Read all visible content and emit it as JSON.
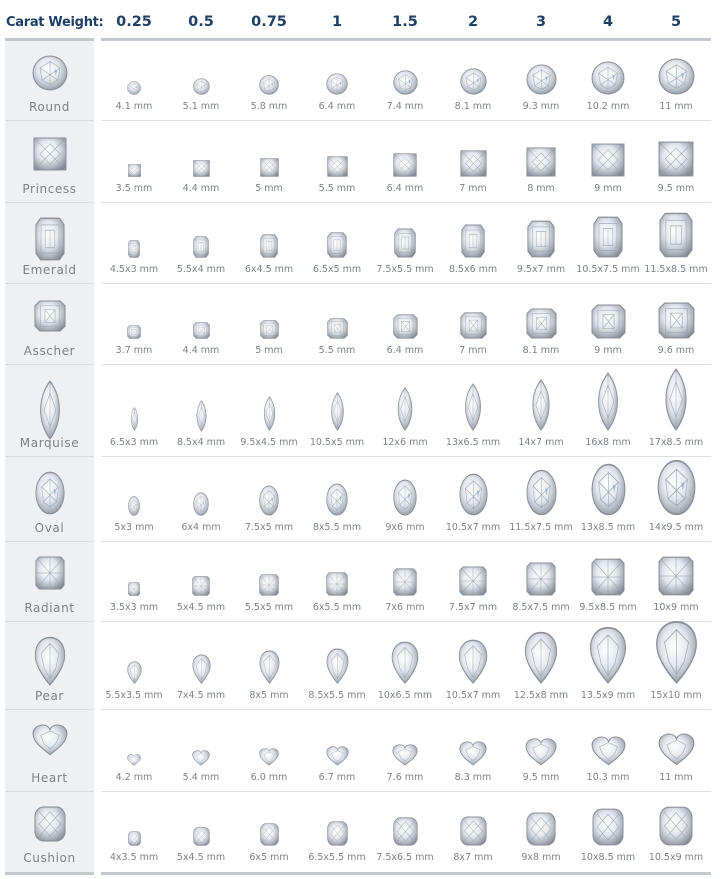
{
  "header": {
    "label": "Carat Weight:",
    "carats": [
      "0.25",
      "0.5",
      "0.75",
      "1",
      "1.5",
      "2",
      "3",
      "4",
      "5"
    ]
  },
  "colors": {
    "header_text": "#1e3f66",
    "label_text": "#7d8287",
    "left_column_bg": "#eef0f3",
    "divider": "#c3c8ce"
  },
  "shapes": [
    {
      "name": "Round",
      "icon": "round-diamond-icon",
      "sizes": [
        "4.1 mm",
        "5.1 mm",
        "5.8 mm",
        "6.4 mm",
        "7.4 mm",
        "8.1 mm",
        "9.3 mm",
        "10.2 mm",
        "11 mm"
      ]
    },
    {
      "name": "Princess",
      "icon": "princess-diamond-icon",
      "sizes": [
        "3.5 mm",
        "4.4 mm",
        "5 mm",
        "5.5 mm",
        "6.4 mm",
        "7 mm",
        "8 mm",
        "9 mm",
        "9.5 mm"
      ]
    },
    {
      "name": "Emerald",
      "icon": "emerald-diamond-icon",
      "sizes": [
        "4.5x3 mm",
        "5.5x4 mm",
        "6x4.5 mm",
        "6.5x5 mm",
        "7.5x5.5 mm",
        "8.5x6 mm",
        "9.5x7 mm",
        "10.5x7.5 mm",
        "11.5x8.5 mm"
      ]
    },
    {
      "name": "Asscher",
      "icon": "asscher-diamond-icon",
      "sizes": [
        "3.7 mm",
        "4.4 mm",
        "5 mm",
        "5.5 mm",
        "6.4 mm",
        "7 mm",
        "8.1 mm",
        "9 mm",
        "9.6 mm"
      ]
    },
    {
      "name": "Marquise",
      "icon": "marquise-diamond-icon",
      "sizes": [
        "6.5x3 mm",
        "8.5x4 mm",
        "9.5x4.5 mm",
        "10.5x5 mm",
        "12x6 mm",
        "13x6.5 mm",
        "14x7 mm",
        "16x8 mm",
        "17x8.5 mm"
      ]
    },
    {
      "name": "Oval",
      "icon": "oval-diamond-icon",
      "sizes": [
        "5x3 mm",
        "6x4 mm",
        "7.5x5 mm",
        "8x5.5 mm",
        "9x6 mm",
        "10.5x7 mm",
        "11.5x7.5 mm",
        "13x8.5 mm",
        "14x9.5 mm"
      ]
    },
    {
      "name": "Radiant",
      "icon": "radiant-diamond-icon",
      "sizes": [
        "3.5x3 mm",
        "5x4.5 mm",
        "5.5x5 mm",
        "6x5.5 mm",
        "7x6 mm",
        "7.5x7 mm",
        "8.5x7.5 mm",
        "9.5x8.5 mm",
        "10x9 mm"
      ]
    },
    {
      "name": "Pear",
      "icon": "pear-diamond-icon",
      "sizes": [
        "5.5x3.5 mm",
        "7x4.5 mm",
        "8x5 mm",
        "8.5x5.5 mm",
        "10x6.5 mm",
        "10.5x7 mm",
        "12.5x8 mm",
        "13.5x9 mm",
        "15x10 mm"
      ]
    },
    {
      "name": "Heart",
      "icon": "heart-diamond-icon",
      "sizes": [
        "4.2 mm",
        "5.4 mm",
        "6.0 mm",
        "6.7 mm",
        "7.6 mm",
        "8.3 mm",
        "9.5 mm",
        "10.3 mm",
        "11 mm"
      ]
    },
    {
      "name": "Cushion",
      "icon": "cushion-diamond-icon",
      "sizes": [
        "4x3.5 mm",
        "5x4.5 mm",
        "6x5 mm",
        "6.5x5.5 mm",
        "7.5x6.5 mm",
        "8x7 mm",
        "9x8 mm",
        "10x8.5 mm",
        "10.5x9 mm"
      ]
    }
  ]
}
